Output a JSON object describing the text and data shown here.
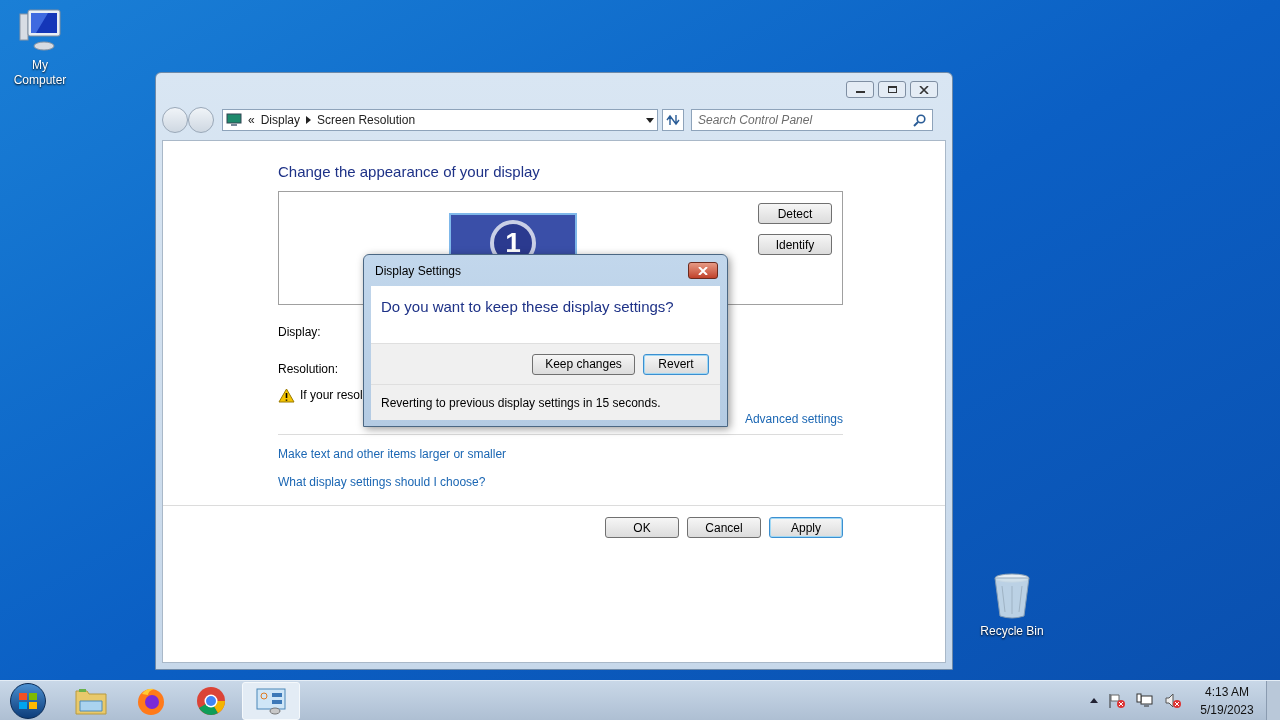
{
  "desktop_icons": [
    {
      "kind": "computer",
      "label": "My Computer"
    },
    {
      "kind": "recycle",
      "label": "Recycle Bin"
    }
  ],
  "window": {
    "address": {
      "overflow": "«",
      "segments": [
        "Display",
        "Screen Resolution"
      ]
    },
    "search": {
      "placeholder": "Search Control Panel"
    },
    "heading": "Change the appearance of your display",
    "monitor_number": "1",
    "side_buttons": [
      "Detect",
      "Identify"
    ],
    "fields": [
      {
        "label": "Display:"
      },
      {
        "label": "Resolution:"
      }
    ],
    "warning": "If your resol",
    "advanced_link": "Advanced settings",
    "links": [
      "Make text and other items larger or smaller",
      "What display settings should I choose?"
    ],
    "footer_buttons": [
      {
        "label": "OK",
        "focused": false
      },
      {
        "label": "Cancel",
        "focused": false
      },
      {
        "label": "Apply",
        "focused": true
      }
    ]
  },
  "dialog": {
    "title": "Display Settings",
    "question": "Do you want to keep these display settings?",
    "buttons": [
      {
        "label": "Keep changes",
        "focused": false
      },
      {
        "label": "Revert",
        "focused": true
      }
    ],
    "countdown": "Reverting to previous display settings in 15 seconds."
  },
  "taskbar": {
    "apps": [
      {
        "kind": "folder",
        "active": false
      },
      {
        "kind": "firefox",
        "active": false
      },
      {
        "kind": "chrome",
        "active": false
      },
      {
        "kind": "control-panel",
        "active": true
      }
    ],
    "clock": {
      "time": "4:13 AM",
      "date": "5/19/2023"
    }
  }
}
